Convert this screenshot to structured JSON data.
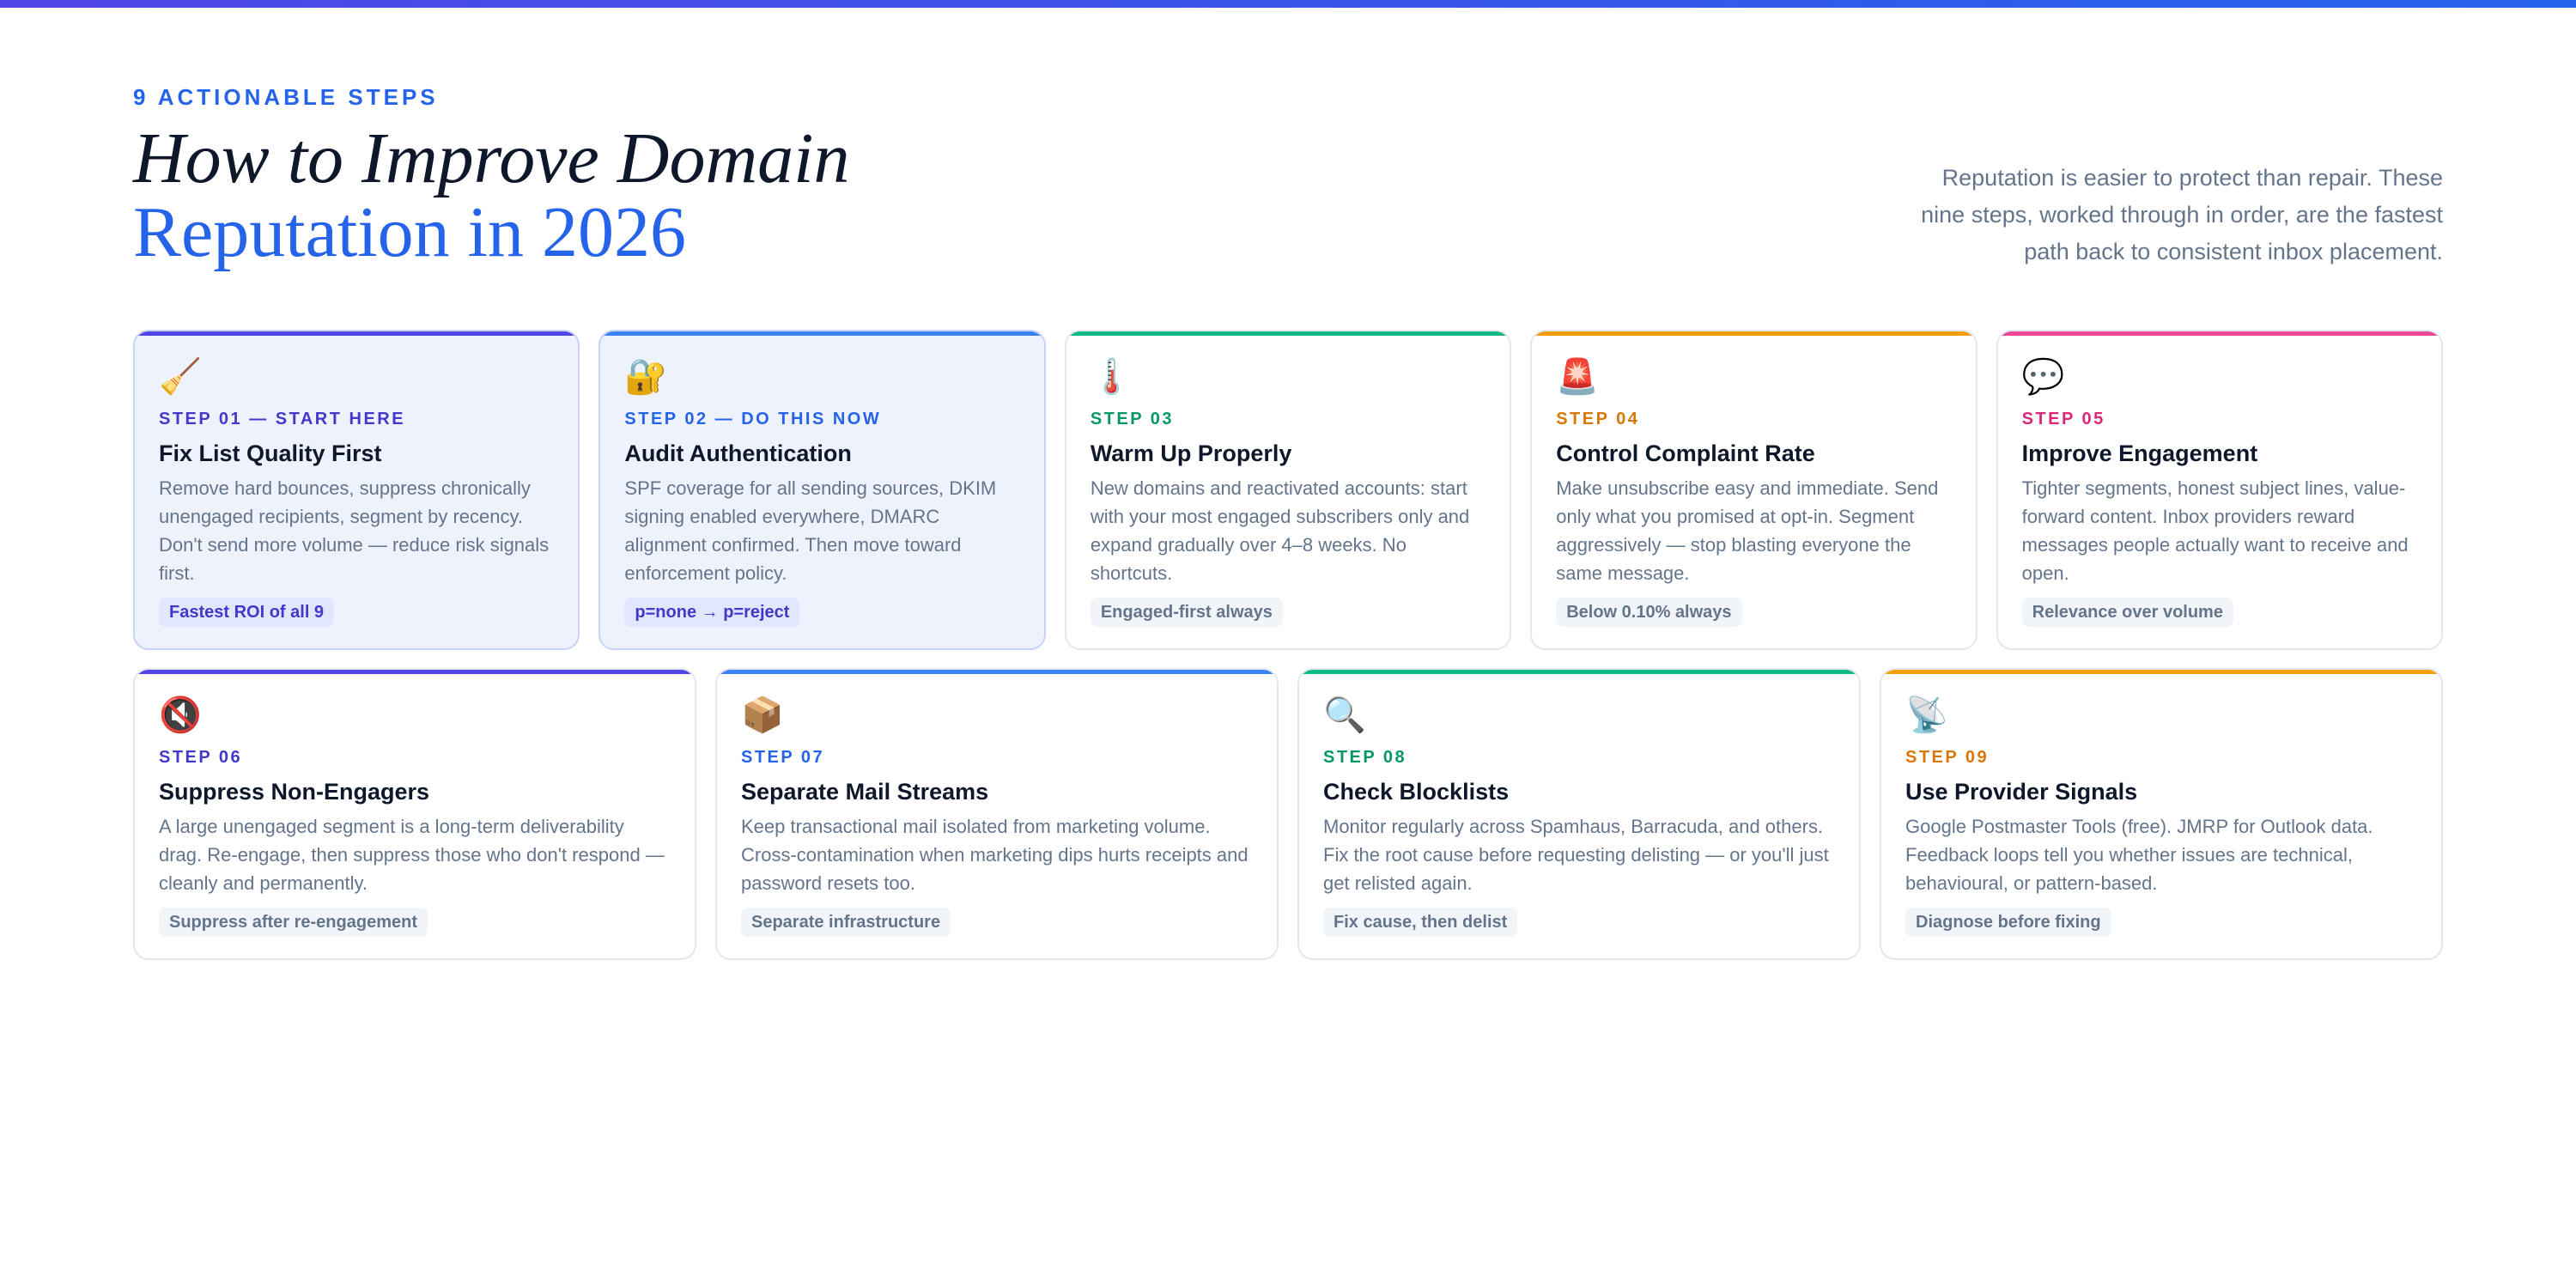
{
  "header": {
    "eyebrow": "9 ACTIONABLE STEPS",
    "title_line1": "How to Improve Domain",
    "title_line2": "Reputation in 2026",
    "intro": "Reputation is easier to protect than repair. These nine steps, worked through in order, are the fastest path back to consistent inbox placement."
  },
  "colors": {
    "indigo": "#4f46e5",
    "blue": "#3b82f6",
    "green": "#10b981",
    "orange": "#f59e0b",
    "pink": "#ec4899",
    "step_text_indigo": "#4338ca",
    "step_text_blue": "#2563eb",
    "step_text_green": "#059669",
    "step_text_orange": "#d97706",
    "step_text_pink": "#db2777",
    "featured_background": "#eef2fd"
  },
  "steps": [
    {
      "icon": "🧹",
      "icon_name": "broom-icon",
      "step": "STEP 01 — START HERE",
      "title": "Fix List Quality First",
      "description": "Remove hard bounces, suppress chronically unengaged recipients, segment by recency. Don't send more volume — reduce risk signals first.",
      "tag": "Fastest ROI of all 9",
      "featured": true,
      "accent": "#4f46e5",
      "step_color": "#4338ca"
    },
    {
      "icon": "🔐",
      "icon_name": "lock-with-key-icon",
      "step": "STEP 02 — DO THIS NOW",
      "title": "Audit Authentication",
      "description": "SPF coverage for all sending sources, DKIM signing enabled everywhere, DMARC alignment confirmed. Then move toward enforcement policy.",
      "tag": "p=none → p=reject",
      "featured": true,
      "accent": "#3b82f6",
      "step_color": "#2563eb"
    },
    {
      "icon": "🌡️",
      "icon_name": "thermometer-icon",
      "step": "STEP 03",
      "title": "Warm Up Properly",
      "description": "New domains and reactivated accounts: start with your most engaged subscribers only and expand gradually over 4–8 weeks. No shortcuts.",
      "tag": "Engaged-first always",
      "featured": false,
      "accent": "#10b981",
      "step_color": "#059669"
    },
    {
      "icon": "🚨",
      "icon_name": "siren-icon",
      "step": "STEP 04",
      "title": "Control Complaint Rate",
      "description": "Make unsubscribe easy and immediate. Send only what you promised at opt-in. Segment aggressively — stop blasting everyone the same message.",
      "tag": "Below 0.10% always",
      "featured": false,
      "accent": "#f59e0b",
      "step_color": "#d97706"
    },
    {
      "icon": "💬",
      "icon_name": "speech-bubble-icon",
      "step": "STEP 05",
      "title": "Improve Engagement",
      "description": "Tighter segments, honest subject lines, value-forward content. Inbox providers reward messages people actually want to receive and open.",
      "tag": "Relevance over volume",
      "featured": false,
      "accent": "#ec4899",
      "step_color": "#db2777"
    },
    {
      "icon": "🔇",
      "icon_name": "muted-speaker-icon",
      "step": "STEP 06",
      "title": "Suppress Non-Engagers",
      "description": "A large unengaged segment is a long-term deliverability drag. Re-engage, then suppress those who don't respond — cleanly and permanently.",
      "tag": "Suppress after re-engagement",
      "featured": false,
      "accent": "#4f46e5",
      "step_color": "#4338ca"
    },
    {
      "icon": "📦",
      "icon_name": "package-icon",
      "step": "STEP 07",
      "title": "Separate Mail Streams",
      "description": "Keep transactional mail isolated from marketing volume. Cross-contamination when marketing dips hurts receipts and password resets too.",
      "tag": "Separate infrastructure",
      "featured": false,
      "accent": "#3b82f6",
      "step_color": "#2563eb"
    },
    {
      "icon": "🔍",
      "icon_name": "magnifying-glass-icon",
      "step": "STEP 08",
      "title": "Check Blocklists",
      "description": "Monitor regularly across Spamhaus, Barracuda, and others. Fix the root cause before requesting delisting — or you'll just get relisted again.",
      "tag": "Fix cause, then delist",
      "featured": false,
      "accent": "#10b981",
      "step_color": "#059669"
    },
    {
      "icon": "📡",
      "icon_name": "satellite-antenna-icon",
      "step": "STEP 09",
      "title": "Use Provider Signals",
      "description": "Google Postmaster Tools (free). JMRP for Outlook data. Feedback loops tell you whether issues are technical, behavioural, or pattern-based.",
      "tag": "Diagnose before fixing",
      "featured": false,
      "accent": "#f59e0b",
      "step_color": "#d97706"
    }
  ]
}
